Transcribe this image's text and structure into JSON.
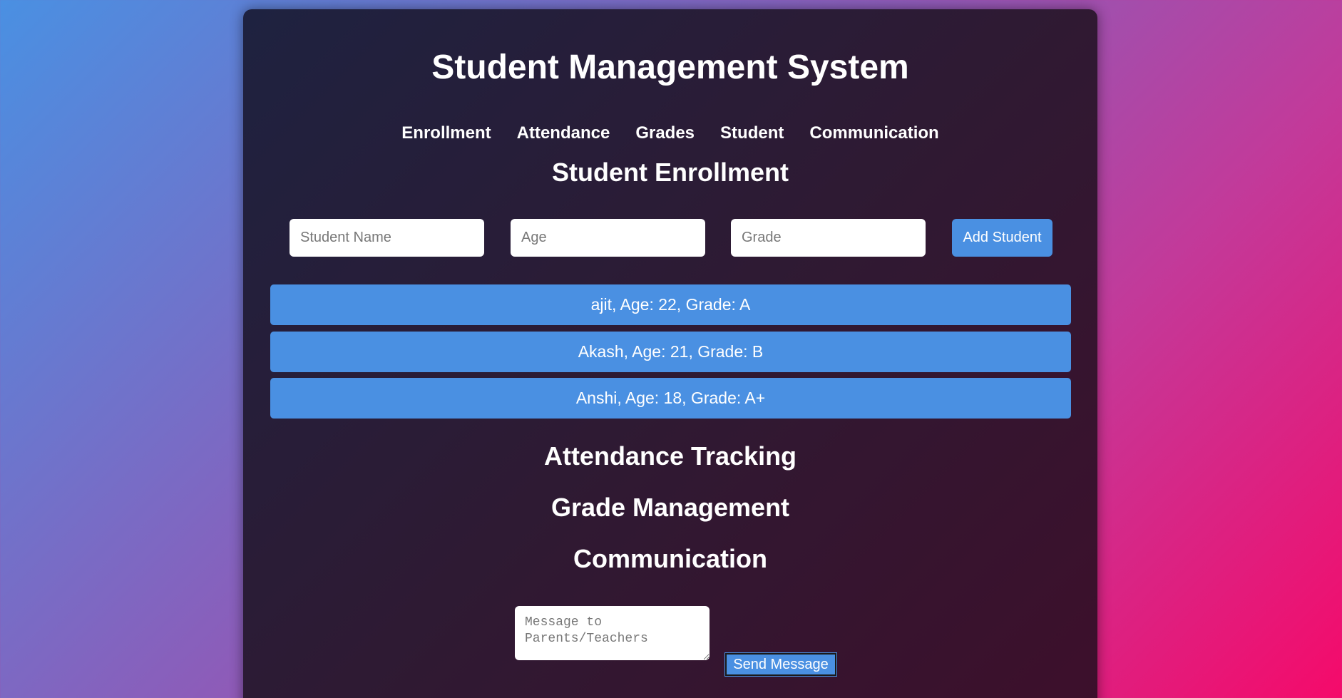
{
  "app": {
    "title": "Student Management System"
  },
  "nav": {
    "items": [
      "Enrollment",
      "Attendance",
      "Grades",
      "Student",
      "Communication"
    ]
  },
  "enrollment": {
    "heading": "Student Enrollment",
    "name_placeholder": "Student Name",
    "age_placeholder": "Age",
    "grade_placeholder": "Grade",
    "add_button": "Add Student",
    "students": [
      "ajit, Age: 22, Grade: A",
      "Akash, Age: 21, Grade: B",
      "Anshi, Age: 18, Grade: A+"
    ]
  },
  "attendance": {
    "heading": "Attendance Tracking"
  },
  "grades": {
    "heading": "Grade Management"
  },
  "communication": {
    "heading": "Communication",
    "message_placeholder": "Message to Parents/Teachers",
    "send_button": "Send Message"
  },
  "colors": {
    "accent": "#4a90e2",
    "card_start": "#1e2240",
    "card_end": "#3d0f2b",
    "bg_start": "#4a90e2",
    "bg_end": "#f50a6a"
  }
}
